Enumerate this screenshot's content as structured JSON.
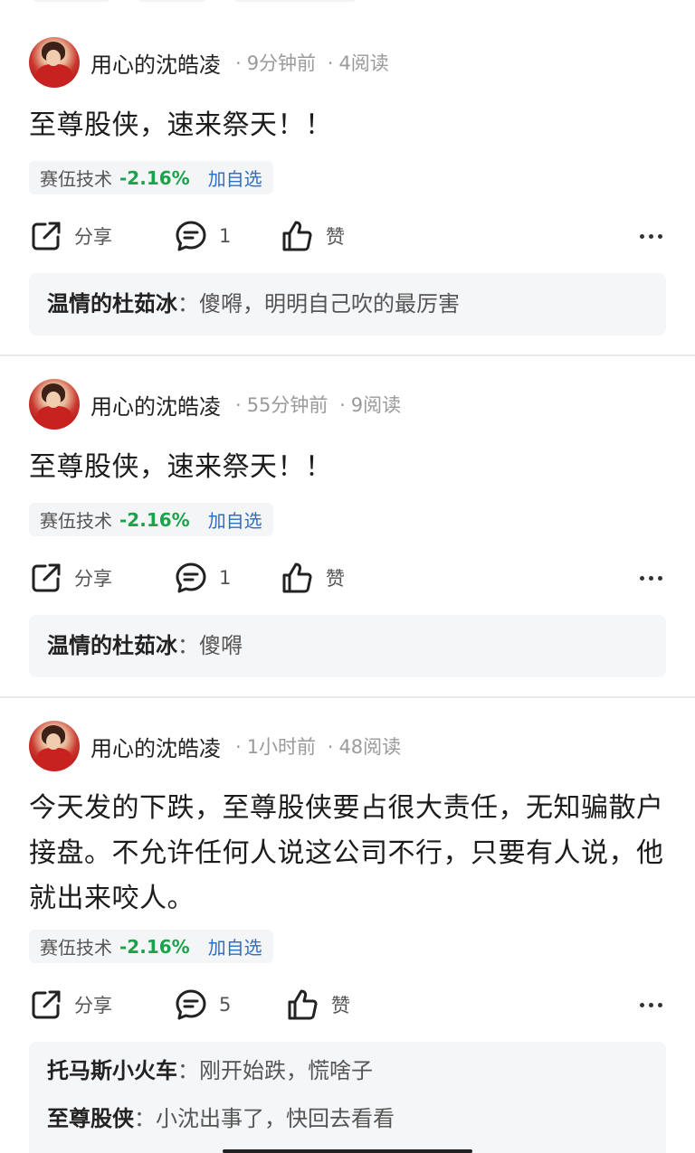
{
  "posts": [
    {
      "author": "用心的沈皓凌",
      "time": "9分钟前",
      "reads": "4阅读",
      "text": "至尊股侠，速来祭天！！",
      "stock": {
        "name": "赛伍技术",
        "change": "-2.16%",
        "add_label": "加自选"
      },
      "share_label": "分享",
      "comment_count": "1",
      "like_label": "赞",
      "comments": [
        {
          "user": "温情的杜茹冰",
          "sep": "：",
          "text": "傻嘚，明明自己吹的最厉害"
        }
      ]
    },
    {
      "author": "用心的沈皓凌",
      "time": "55分钟前",
      "reads": "9阅读",
      "text": "至尊股侠，速来祭天！！",
      "stock": {
        "name": "赛伍技术",
        "change": "-2.16%",
        "add_label": "加自选"
      },
      "share_label": "分享",
      "comment_count": "1",
      "like_label": "赞",
      "comments": [
        {
          "user": "温情的杜茹冰",
          "sep": "：",
          "text": "傻嘚"
        }
      ]
    },
    {
      "author": "用心的沈皓凌",
      "time": "1小时前",
      "reads": "48阅读",
      "text": "今天发的下跌，至尊股侠要占很大责任，无知骗散户接盘。不允许任何人说这公司不行，只要有人说，他就出来咬人。",
      "stock": {
        "name": "赛伍技术",
        "change": "-2.16%",
        "add_label": "加自选"
      },
      "share_label": "分享",
      "comment_count": "5",
      "like_label": "赞",
      "comments": [
        {
          "user": "托马斯小火车",
          "sep": "：",
          "text": "刚开始跌，慌啥子"
        },
        {
          "user": "至尊股侠",
          "sep": "：",
          "text": "小沈出事了，快回去看看"
        }
      ]
    }
  ],
  "meta_separator": "·",
  "colors": {
    "down": "#1aa34a",
    "link": "#2f6fc4",
    "tag_bg": "#f4f5f7",
    "comment_bg": "#f5f6f8"
  },
  "icons": [
    "share-icon",
    "comment-icon",
    "like-icon",
    "more-icon"
  ]
}
